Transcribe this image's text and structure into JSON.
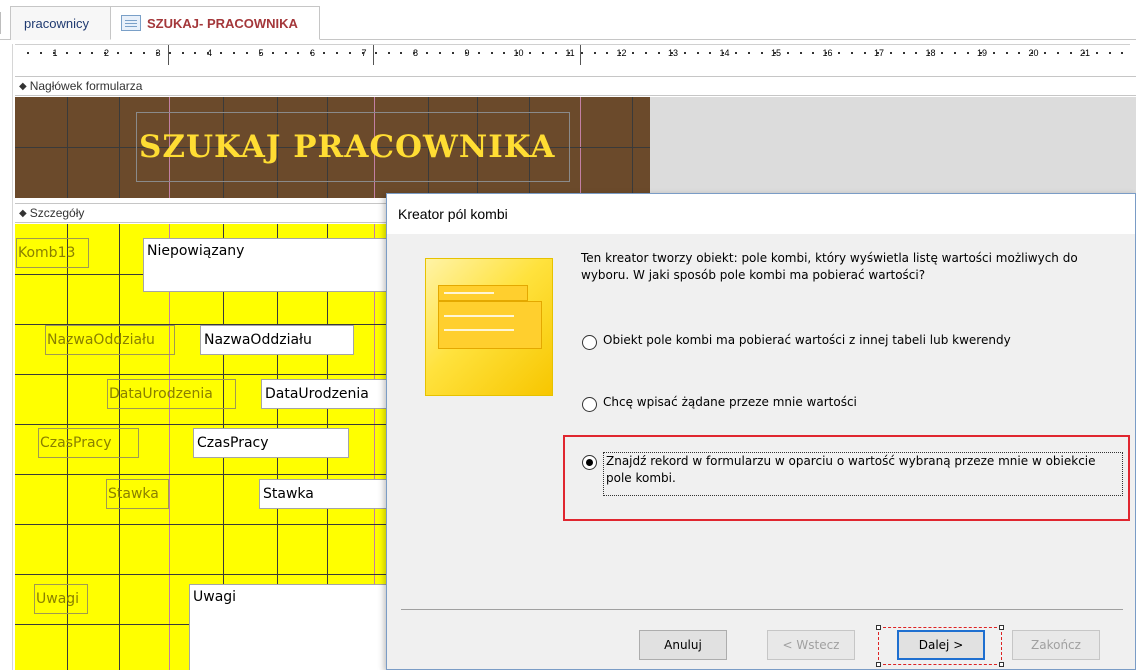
{
  "tabs": [
    {
      "label": "pracownicy",
      "active": false
    },
    {
      "label": "SZUKAJ- PRACOWNIKA",
      "active": true
    }
  ],
  "ruler": {
    "numbers": [
      "1",
      "2",
      "3",
      "4",
      "5",
      "6",
      "7",
      "8",
      "9",
      "10",
      "11",
      "12",
      "13",
      "14",
      "15",
      "16",
      "17",
      "18",
      "19",
      "20",
      "21"
    ]
  },
  "sections": {
    "header_label": "Nagłówek formularza",
    "detail_label": "Szczegóły"
  },
  "form_header": {
    "title": "SZUKAJ PRACOWNIKA"
  },
  "form_detail": {
    "combo_label": "Komb13",
    "combo_value": "Niepowiązany",
    "fields": [
      {
        "label": "NazwaOddziału",
        "value": "NazwaOddziału"
      },
      {
        "label": "DataUrodzenia",
        "value": "DataUrodzenia"
      },
      {
        "label": "CzasPracy",
        "value": "CzasPracy"
      },
      {
        "label": "Stawka",
        "value": "Stawka"
      },
      {
        "label": "Uwagi",
        "value": "Uwagi"
      }
    ]
  },
  "dialog": {
    "title": "Kreator pól kombi",
    "description": "Ten kreator tworzy obiekt: pole kombi, który wyświetla listę wartości możliwych do wyboru. W jaki sposób pole kombi ma pobierać wartości?",
    "options": [
      {
        "label": "Obiekt pole kombi ma pobierać wartości z innej tabeli lub kwerendy",
        "selected": false
      },
      {
        "label": "Chcę wpisać żądane przeze mnie wartości",
        "selected": false
      },
      {
        "label": "Znajdź rekord w formularzu w oparciu o wartość wybraną przeze mnie w obiekcie pole kombi.",
        "selected": true
      }
    ],
    "buttons": {
      "cancel": "Anuluj",
      "back": "< Wstecz",
      "next": "Dalej >",
      "finish": "Zakończ"
    }
  },
  "colors": {
    "header_bg": "#6b4a2b",
    "title_text": "#ffdd33",
    "detail_bg": "#ffff00",
    "active_tab": "#a4373a",
    "highlight": "#e0262f"
  }
}
